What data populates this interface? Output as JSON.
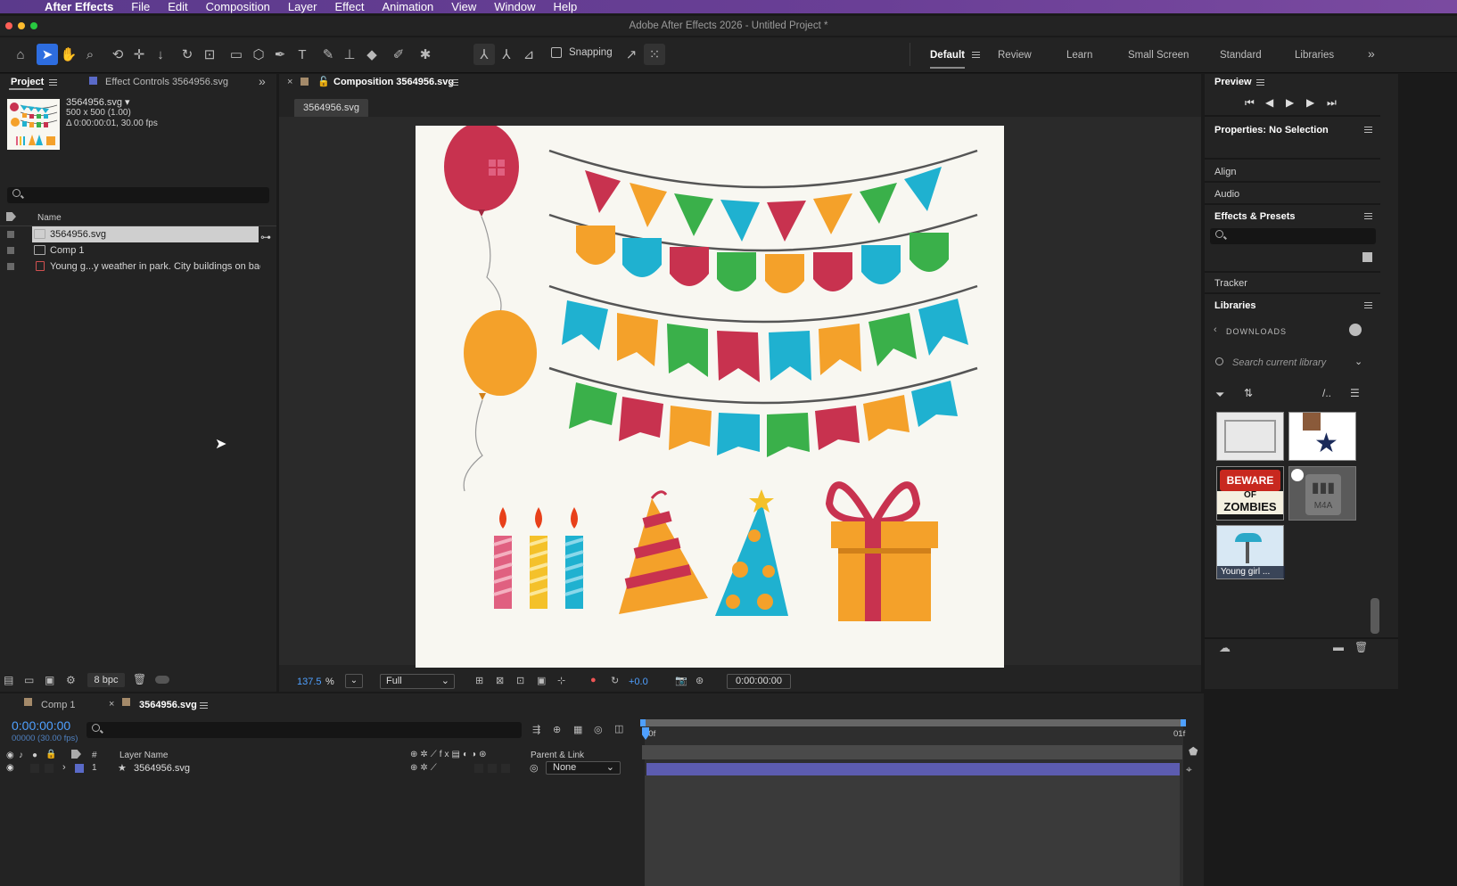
{
  "menubar": {
    "app": "After Effects",
    "items": [
      "File",
      "Edit",
      "Composition",
      "Layer",
      "Effect",
      "Animation",
      "View",
      "Window",
      "Help"
    ]
  },
  "window": {
    "title": "Adobe After Effects 2026 - Untitled Project *"
  },
  "toolbar": {
    "snapping_label": "Snapping",
    "workspaces": [
      "Default",
      "Review",
      "Learn",
      "Small Screen",
      "Standard",
      "Libraries"
    ],
    "active_workspace": "Default"
  },
  "project": {
    "tab_project": "Project",
    "tab_effect_controls": "Effect Controls 3564956.svg",
    "selected_name": "3564956.svg ▾",
    "selected_dims": "500 x 500 (1.00)",
    "selected_duration": "Δ 0:00:00:01, 30.00 fps",
    "search_placeholder": "",
    "column_name": "Name",
    "items": [
      {
        "name": "3564956.svg",
        "selected": true
      },
      {
        "name": "Comp 1",
        "selected": false
      },
      {
        "name": "Young g...y weather in park. City buildings on backg",
        "selected": false
      }
    ],
    "bpc": "8 bpc"
  },
  "composition": {
    "tab_label": "Composition 3564956.svg",
    "sub_tab": "3564956.svg",
    "zoom": "137.5",
    "zoom_unit": "%",
    "resolution": "Full",
    "exposure": "+0.0",
    "timecode": "0:00:00:00"
  },
  "right": {
    "preview": "Preview",
    "properties": "Properties: No Selection",
    "align": "Align",
    "audio": "Audio",
    "effects_presets": "Effects & Presets",
    "tracker": "Tracker",
    "libraries": "Libraries",
    "downloads": "DOWNLOADS",
    "library_search_placeholder": "Search current library",
    "thumbs": [
      {
        "label": "",
        "kind": "frame"
      },
      {
        "label": "",
        "kind": "star"
      },
      {
        "label": "BEWARE",
        "label2": "OF",
        "label3": "ZOMBIES",
        "kind": "sign"
      },
      {
        "label": "M4A",
        "kind": "audio"
      },
      {
        "label": "Young girl ...",
        "kind": "photo"
      }
    ]
  },
  "timeline": {
    "tab_comp1": "Comp 1",
    "tab_active": "3564956.svg",
    "timecode": "0:00:00:00",
    "frame_info": "00000 (30.00 fps)",
    "col_layer_name": "Layer Name",
    "col_num": "#",
    "col_parent": "Parent & Link",
    "ruler_start": "00f",
    "ruler_end": "01f",
    "layer": {
      "index": "1",
      "name": "3564956.svg",
      "parent": "None"
    }
  },
  "colors": {
    "accent_blue": "#2d6de0",
    "timecode_blue": "#4fa0ff",
    "layer_bar": "#5c5cb0",
    "menubar_purple": "#5b3a8c"
  }
}
